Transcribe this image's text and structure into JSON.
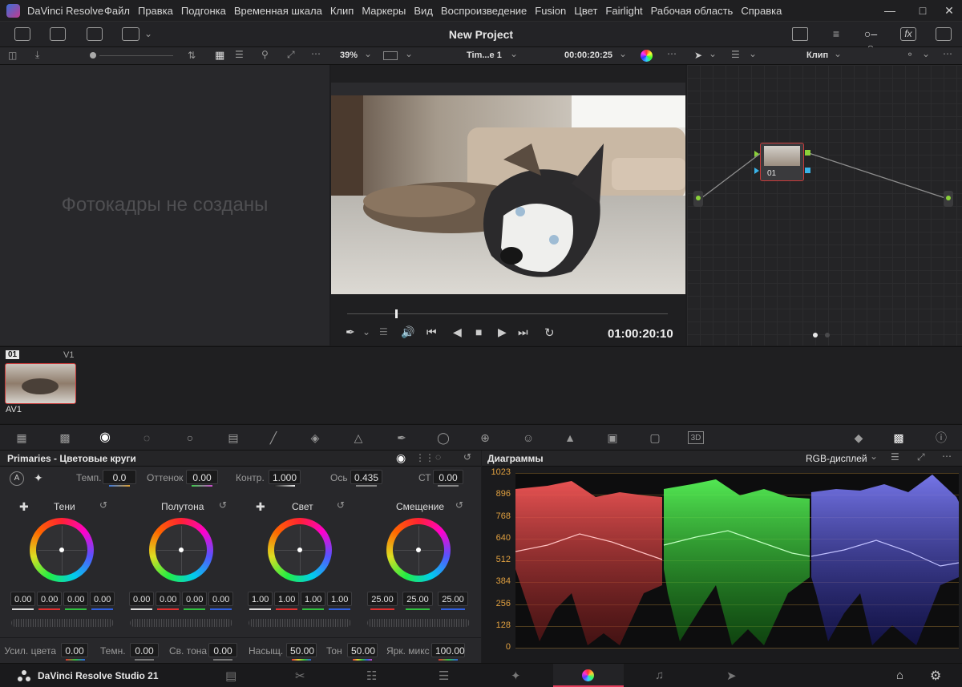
{
  "app": {
    "name": "DaVinci Resolve",
    "menus": [
      "Файл",
      "Правка",
      "Подгонка",
      "Временная шкала",
      "Клип",
      "Маркеры",
      "Вид",
      "Воспроизведение",
      "Fusion",
      "Цвет",
      "Fairlight",
      "Рабочая область",
      "Справка"
    ],
    "project_title": "New Project"
  },
  "viewer": {
    "zoom": "39%",
    "timeline_name": "Tim...e 1",
    "timecode_top": "00:00:20:25",
    "timecode_bottom": "01:00:20:10",
    "playhead_fraction": 0.15
  },
  "gallery": {
    "empty_message": "Фотокадры не созданы"
  },
  "nodes": {
    "mode": "Клип",
    "node_label": "01"
  },
  "timeline": {
    "clip_number": "01",
    "track": "V1",
    "clip_name": "AV1"
  },
  "primaries": {
    "title": "Primaries - Цветовые круги",
    "params_top": [
      {
        "label": "Темп.",
        "value": "0.0"
      },
      {
        "label": "Оттенок",
        "value": "0.00"
      },
      {
        "label": "Контр.",
        "value": "1.000"
      },
      {
        "label": "Ось",
        "value": "0.435"
      },
      {
        "label": "СТ",
        "value": "0.00"
      }
    ],
    "wheels": [
      {
        "name": "Тени",
        "values": [
          "0.00",
          "0.00",
          "0.00",
          "0.00"
        ]
      },
      {
        "name": "Полутона",
        "values": [
          "0.00",
          "0.00",
          "0.00",
          "0.00"
        ]
      },
      {
        "name": "Свет",
        "values": [
          "1.00",
          "1.00",
          "1.00",
          "1.00"
        ]
      },
      {
        "name": "Смещение",
        "values": [
          "25.00",
          "25.00",
          "25.00"
        ]
      }
    ],
    "params_bottom": [
      {
        "label": "Усил. цвета",
        "value": "0.00"
      },
      {
        "label": "Темн.",
        "value": "0.00"
      },
      {
        "label": "Св. тона",
        "value": "0.00"
      },
      {
        "label": "Насыщ.",
        "value": "50.00"
      },
      {
        "label": "Тон",
        "value": "50.00"
      },
      {
        "label": "Ярк. микс",
        "value": "100.00"
      }
    ]
  },
  "scopes": {
    "title": "Диаграммы",
    "mode": "RGB-дисплей",
    "axis_labels": [
      "1023",
      "896",
      "768",
      "640",
      "512",
      "384",
      "256",
      "128",
      "0"
    ]
  },
  "bottom": {
    "product": "DaVinci Resolve Studio 21"
  },
  "colors": {
    "accent_red": "#c83a3a",
    "node_green": "#8bd13a",
    "selected_page": "#e33c5a"
  }
}
